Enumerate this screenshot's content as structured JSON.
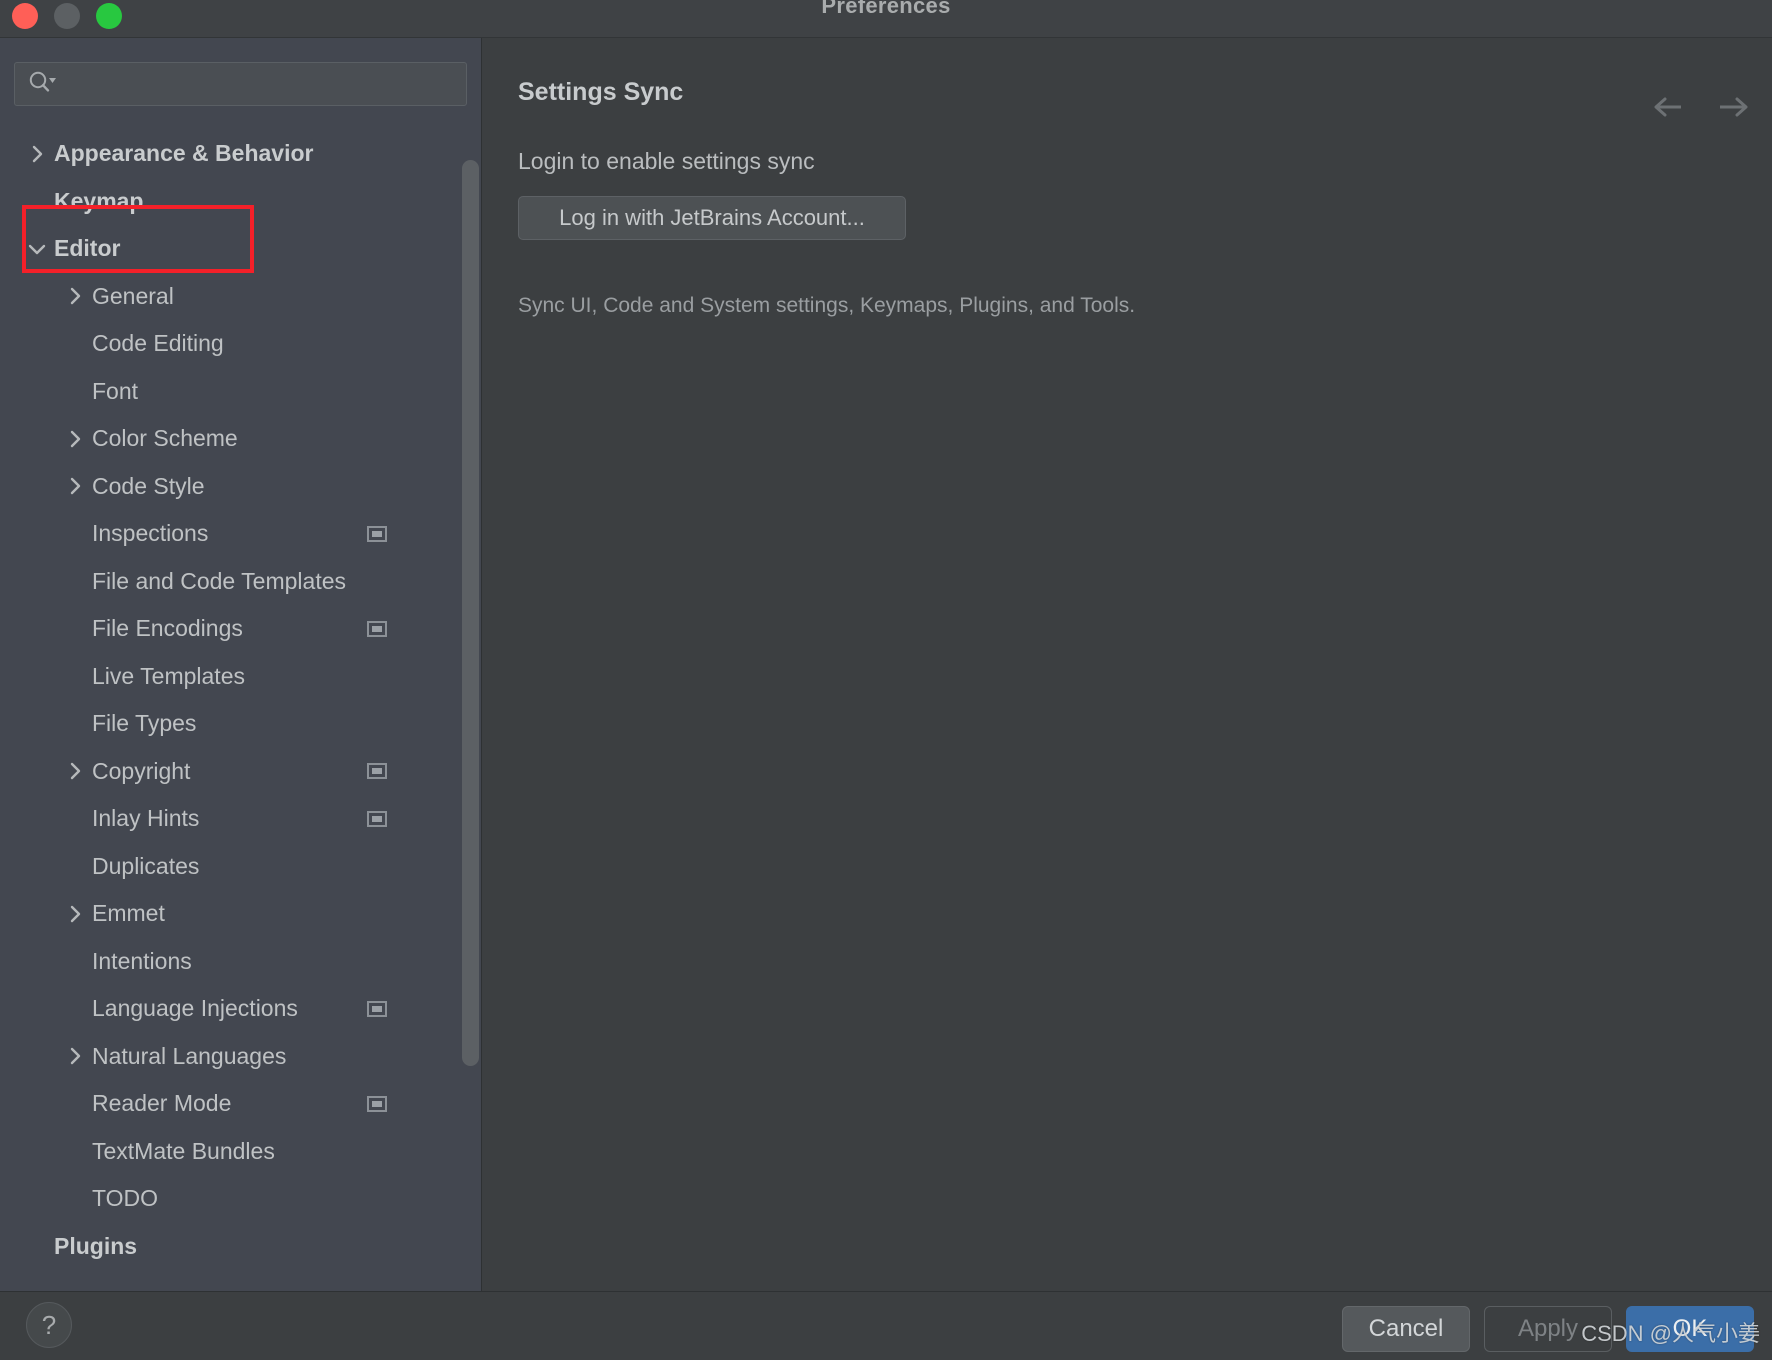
{
  "window": {
    "title": "Preferences",
    "traffic_lights": [
      "close",
      "minimize",
      "zoom"
    ]
  },
  "sidebar": {
    "search": {
      "value": "",
      "placeholder": "",
      "icon": "search-icon"
    },
    "tree": [
      {
        "label": "Appearance & Behavior",
        "depth": 0,
        "chevron": "right",
        "bold": true,
        "scope_icon": false
      },
      {
        "label": "Keymap",
        "depth": 0,
        "chevron": "none",
        "bold": true,
        "scope_icon": false
      },
      {
        "label": "Editor",
        "depth": 0,
        "chevron": "down",
        "bold": true,
        "scope_icon": false
      },
      {
        "label": "General",
        "depth": 1,
        "chevron": "right",
        "bold": false,
        "scope_icon": false
      },
      {
        "label": "Code Editing",
        "depth": 1,
        "chevron": "none",
        "bold": false,
        "scope_icon": false
      },
      {
        "label": "Font",
        "depth": 1,
        "chevron": "none",
        "bold": false,
        "scope_icon": false
      },
      {
        "label": "Color Scheme",
        "depth": 1,
        "chevron": "right",
        "bold": false,
        "scope_icon": false
      },
      {
        "label": "Code Style",
        "depth": 1,
        "chevron": "right",
        "bold": false,
        "scope_icon": false
      },
      {
        "label": "Inspections",
        "depth": 1,
        "chevron": "none",
        "bold": false,
        "scope_icon": true
      },
      {
        "label": "File and Code Templates",
        "depth": 1,
        "chevron": "none",
        "bold": false,
        "scope_icon": false
      },
      {
        "label": "File Encodings",
        "depth": 1,
        "chevron": "none",
        "bold": false,
        "scope_icon": true
      },
      {
        "label": "Live Templates",
        "depth": 1,
        "chevron": "none",
        "bold": false,
        "scope_icon": false
      },
      {
        "label": "File Types",
        "depth": 1,
        "chevron": "none",
        "bold": false,
        "scope_icon": false
      },
      {
        "label": "Copyright",
        "depth": 1,
        "chevron": "right",
        "bold": false,
        "scope_icon": true
      },
      {
        "label": "Inlay Hints",
        "depth": 1,
        "chevron": "none",
        "bold": false,
        "scope_icon": true
      },
      {
        "label": "Duplicates",
        "depth": 1,
        "chevron": "none",
        "bold": false,
        "scope_icon": false
      },
      {
        "label": "Emmet",
        "depth": 1,
        "chevron": "right",
        "bold": false,
        "scope_icon": false
      },
      {
        "label": "Intentions",
        "depth": 1,
        "chevron": "none",
        "bold": false,
        "scope_icon": false
      },
      {
        "label": "Language Injections",
        "depth": 1,
        "chevron": "none",
        "bold": false,
        "scope_icon": true
      },
      {
        "label": "Natural Languages",
        "depth": 1,
        "chevron": "right",
        "bold": false,
        "scope_icon": false
      },
      {
        "label": "Reader Mode",
        "depth": 1,
        "chevron": "none",
        "bold": false,
        "scope_icon": true
      },
      {
        "label": "TextMate Bundles",
        "depth": 1,
        "chevron": "none",
        "bold": false,
        "scope_icon": false
      },
      {
        "label": "TODO",
        "depth": 1,
        "chevron": "none",
        "bold": false,
        "scope_icon": false
      },
      {
        "label": "Plugins",
        "depth": 0,
        "chevron": "none",
        "bold": true,
        "scope_icon": false
      }
    ],
    "annotation": {
      "color": "#f42029",
      "target_label": "Editor"
    }
  },
  "main": {
    "title": "Settings Sync",
    "nav_back_icon": "arrow-left-icon",
    "nav_forward_icon": "arrow-right-icon",
    "subtitle": "Login to enable settings sync",
    "login_button": "Log in with JetBrains Account...",
    "description": "Sync UI, Code and System settings, Keymaps, Plugins, and Tools."
  },
  "bottom": {
    "help_label": "?",
    "cancel_label": "Cancel",
    "apply_label": "Apply",
    "ok_label": "OK",
    "watermark": "CSDN @人气小姜"
  },
  "colors": {
    "accent": "#3b6ea8",
    "annotation": "#f42029",
    "sidebar_bg": "#434750",
    "panel_bg": "#3c3f41"
  }
}
